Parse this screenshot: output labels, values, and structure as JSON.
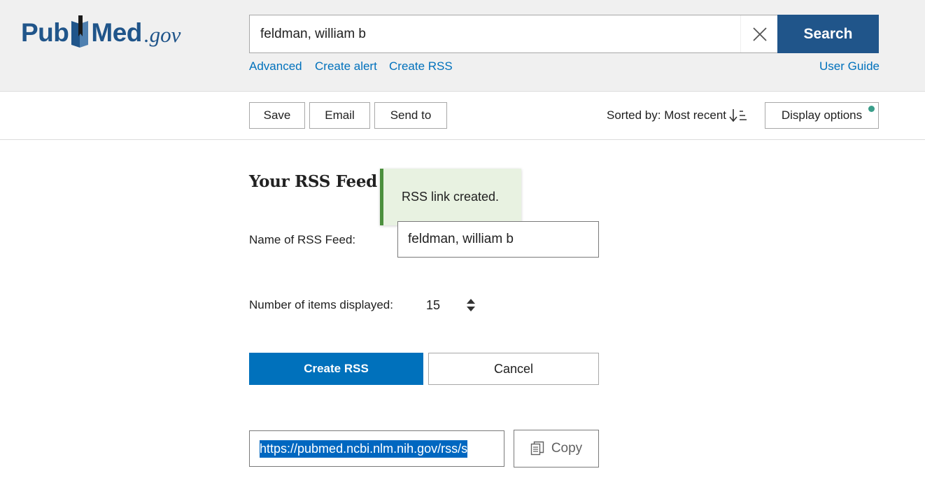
{
  "header": {
    "logo": {
      "pub": "Pub",
      "med": "Med",
      "gov": ".gov"
    },
    "search": {
      "value": "feldman, william b",
      "button_label": "Search",
      "clear_icon": "close-icon"
    },
    "links": {
      "advanced": "Advanced",
      "create_alert": "Create alert",
      "create_rss": "Create RSS",
      "user_guide": "User Guide"
    }
  },
  "toolbar": {
    "save": "Save",
    "email": "Email",
    "send_to": "Send to",
    "sorted_by": "Sorted by: Most recent",
    "sort_icon": "sort-descending-icon",
    "display_options": "Display options",
    "display_options_indicator_color": "#3a9e8a"
  },
  "rss_panel": {
    "title": "Your RSS Feed",
    "toast": "RSS link created.",
    "name_label": "Name of RSS Feed:",
    "name_value": "feldman, william b",
    "items_label": "Number of items displayed:",
    "items_value": "15",
    "create_button": "Create RSS",
    "cancel_button": "Cancel",
    "url": "https://pubmed.ncbi.nlm.nih.gov/rss/s",
    "copy_button": "Copy"
  },
  "colors": {
    "brand": "#20558a",
    "link": "#0071bc",
    "primary_button": "#0071bc",
    "toast_bg": "#e8f2e1",
    "toast_border": "#4b8f3d",
    "selection": "#0067c0"
  }
}
